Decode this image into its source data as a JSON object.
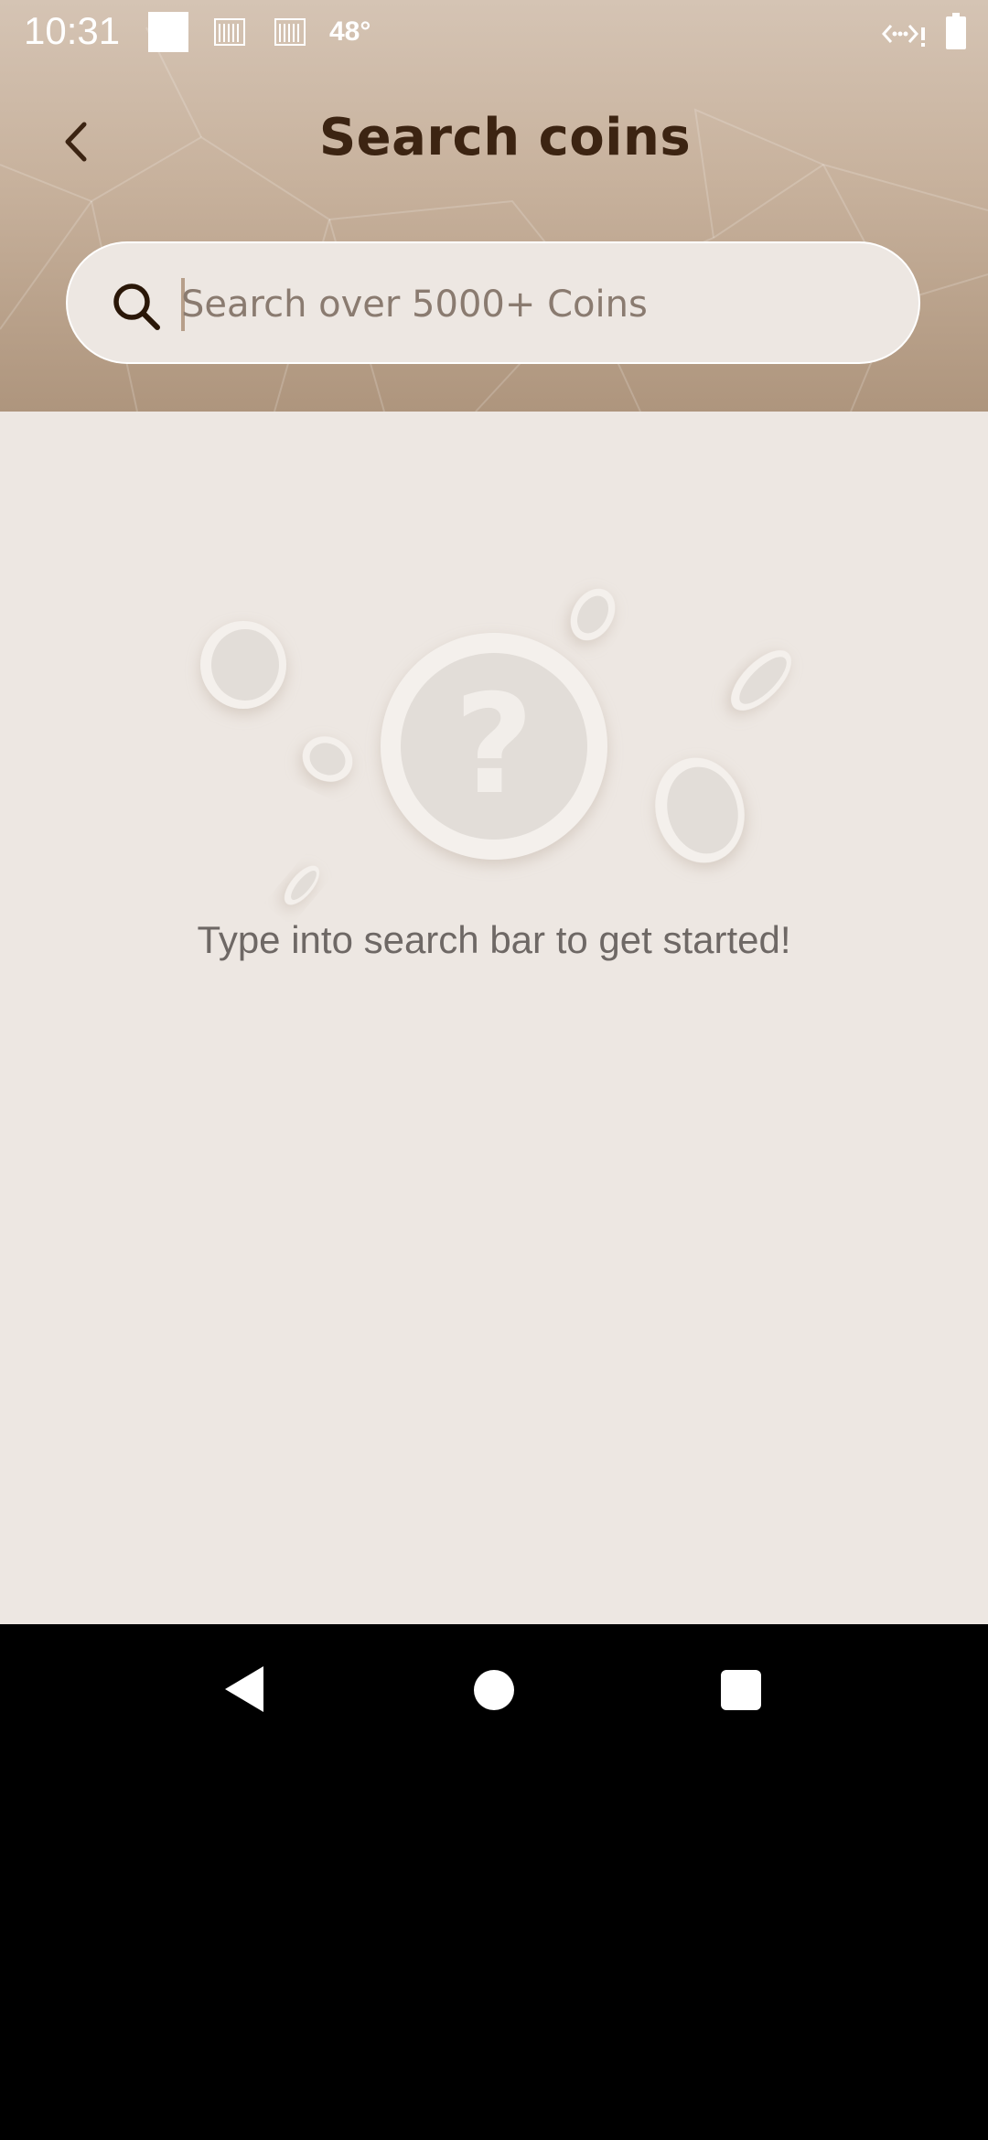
{
  "status_bar": {
    "time": "10:31",
    "temperature": "48°",
    "icons": [
      "notification-square-icon",
      "notification-icon",
      "notification-icon",
      "signal-icon",
      "battery-icon"
    ]
  },
  "header": {
    "title": "Search coins",
    "back_icon": "chevron-left-icon"
  },
  "search": {
    "placeholder": "Search over 5000+ Coins",
    "value": "",
    "icon": "search-icon"
  },
  "empty_state": {
    "illustration": "coins-question-icon",
    "message": "Type into search bar to get started!"
  },
  "nav_bar": {
    "buttons": [
      "back-triangle-icon",
      "home-circle-icon",
      "recents-square-icon"
    ]
  },
  "colors": {
    "header_top": "#d5c4b4",
    "header_bottom": "#ae957d",
    "background": "#ede7e2",
    "title": "#3c2412",
    "message": "#6e6865"
  }
}
